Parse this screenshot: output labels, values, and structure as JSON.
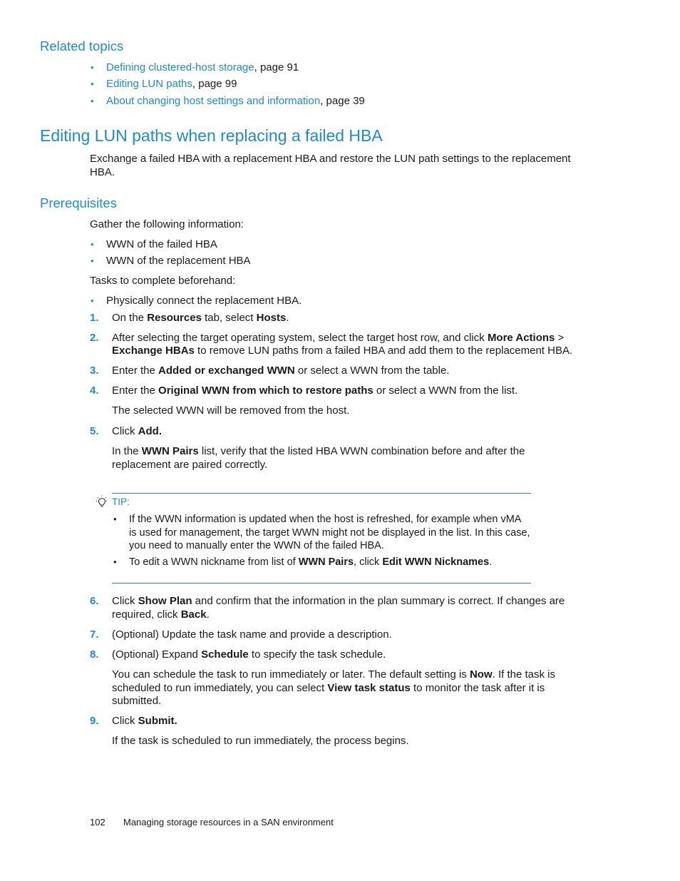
{
  "related_topics": {
    "heading": "Related topics",
    "items": [
      {
        "link": "Defining clustered-host storage",
        "suffix": ", page 91"
      },
      {
        "link": "Editing LUN paths",
        "suffix": ", page 99"
      },
      {
        "link": "About changing host settings and information",
        "suffix": ", page 39"
      }
    ]
  },
  "section": {
    "title": "Editing LUN paths when replacing a failed HBA",
    "intro_line1": "Exchange a failed HBA with a replacement HBA and restore the LUN path settings to the replacement",
    "intro_line2": "HBA."
  },
  "prerequisites": {
    "heading": "Prerequisites",
    "gather_label": "Gather the following information:",
    "gather_items": [
      "WWN of the failed HBA",
      "WWN of the replacement HBA"
    ],
    "tasks_label": "Tasks to complete beforehand:",
    "task_items": [
      "Physically connect the replacement HBA."
    ]
  },
  "steps": [
    {
      "num": "1.",
      "parts": [
        "On the ",
        "Resources",
        " tab, select ",
        "Hosts",
        "."
      ]
    },
    {
      "num": "2.",
      "line1": [
        "After selecting the target operating system, select the target host row, and click ",
        "More Actions",
        " >"
      ],
      "line2": [
        "Exchange HBAs",
        " to remove LUN paths from a failed HBA and add them to the replacement HBA."
      ]
    },
    {
      "num": "3.",
      "parts": [
        "Enter the ",
        "Added or exchanged WWN",
        " or select a WWN from the table."
      ]
    },
    {
      "num": "4.",
      "parts": [
        "Enter the ",
        "Original WWN from which to restore paths",
        " or select a WWN from the list."
      ],
      "note": "The selected WWN will be removed from the host."
    },
    {
      "num": "5.",
      "parts": [
        "Click ",
        "Add."
      ],
      "note_line1": [
        "In the ",
        "WWN Pairs",
        " list, verify that the listed HBA WWN combination before and after the"
      ],
      "note_line2": "replacement are paired correctly."
    },
    {
      "num": "6.",
      "line1": [
        "Click ",
        "Show Plan",
        " and confirm that the information in the plan summary is correct. If changes are"
      ],
      "line2": [
        "required, click ",
        "Back",
        "."
      ]
    },
    {
      "num": "7.",
      "text": "(Optional) Update the task name and provide a description."
    },
    {
      "num": "8.",
      "parts": [
        "(Optional) Expand ",
        "Schedule",
        " to specify the task schedule."
      ],
      "note_line1": [
        "You can schedule the task to run immediately or later. The default setting is ",
        "Now",
        ". If the task is"
      ],
      "note_line2": [
        "scheduled to run immediately, you can select ",
        "View task status",
        " to monitor the task after it is"
      ],
      "note_line3": "submitted."
    },
    {
      "num": "9.",
      "parts": [
        "Click ",
        "Submit."
      ],
      "note": "If the task is scheduled to run immediately, the process begins."
    }
  ],
  "tip": {
    "label": "TIP:",
    "icon": "lightbulb-icon",
    "items": [
      {
        "lines": [
          "If the WWN information is updated when the host is refreshed, for example when vMA",
          "is used for management, the target WWN might not be displayed in the list. In this case,",
          "you need to manually enter the WWN of the failed HBA."
        ]
      },
      {
        "parts": [
          "To edit a WWN nickname from list of ",
          "WWN Pairs",
          ", click ",
          "Edit WWN Nicknames",
          "."
        ]
      }
    ]
  },
  "footer": {
    "page_number": "102",
    "chapter": "Managing storage resources in a SAN environment"
  },
  "colors": {
    "accent": "#1a8ccf",
    "text": "#1a1a1a"
  }
}
